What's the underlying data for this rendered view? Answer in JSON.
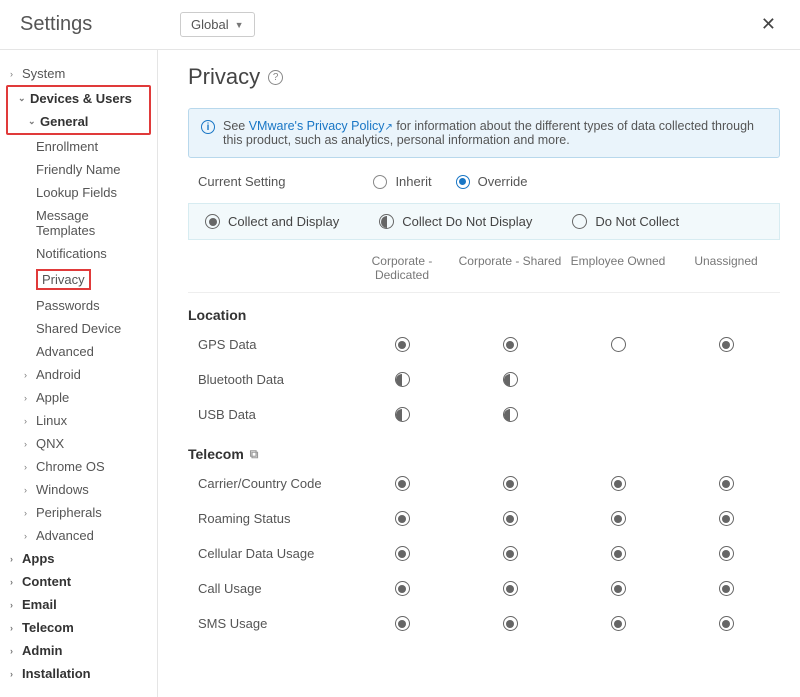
{
  "header": {
    "title": "Settings",
    "scope": "Global"
  },
  "sidebar": {
    "system": "System",
    "devices_users": "Devices & Users",
    "general": "General",
    "general_items": [
      "Enrollment",
      "Friendly Name",
      "Lookup Fields",
      "Message Templates",
      "Notifications",
      "Privacy",
      "Passwords",
      "Shared Device",
      "Advanced"
    ],
    "platforms": [
      "Android",
      "Apple",
      "Linux",
      "QNX",
      "Chrome OS",
      "Windows",
      "Peripherals",
      "Advanced"
    ],
    "top_items": [
      "Apps",
      "Content",
      "Email",
      "Telecom",
      "Admin",
      "Installation"
    ]
  },
  "page": {
    "title": "Privacy"
  },
  "banner": {
    "prefix": "See ",
    "link": "VMware's Privacy Policy",
    "suffix": " for information about the different types of data collected through this product, such as analytics, personal information and more."
  },
  "current_setting": {
    "label": "Current Setting",
    "inherit": "Inherit",
    "override": "Override",
    "selected": "override"
  },
  "legend": {
    "collect_display": "Collect and Display",
    "collect_no_display": "Collect Do Not Display",
    "no_collect": "Do Not Collect"
  },
  "columns": [
    "Corporate - Dedicated",
    "Corporate - Shared",
    "Employee Owned",
    "Unassigned"
  ],
  "sections": [
    {
      "name": "Location",
      "rows": [
        {
          "label": "GPS Data",
          "states": [
            "full",
            "full",
            "empty",
            "full"
          ]
        },
        {
          "label": "Bluetooth Data",
          "states": [
            "half",
            "half",
            null,
            null
          ]
        },
        {
          "label": "USB Data",
          "states": [
            "half",
            "half",
            null,
            null
          ]
        }
      ]
    },
    {
      "name": "Telecom",
      "icon": true,
      "rows": [
        {
          "label": "Carrier/Country Code",
          "states": [
            "full",
            "full",
            "full",
            "full"
          ]
        },
        {
          "label": "Roaming Status",
          "states": [
            "full",
            "full",
            "full",
            "full"
          ]
        },
        {
          "label": "Cellular Data Usage",
          "states": [
            "full",
            "full",
            "full",
            "full"
          ]
        },
        {
          "label": "Call Usage",
          "states": [
            "full",
            "full",
            "full",
            "full"
          ]
        },
        {
          "label": "SMS Usage",
          "states": [
            "full",
            "full",
            "full",
            "full"
          ]
        }
      ]
    }
  ]
}
